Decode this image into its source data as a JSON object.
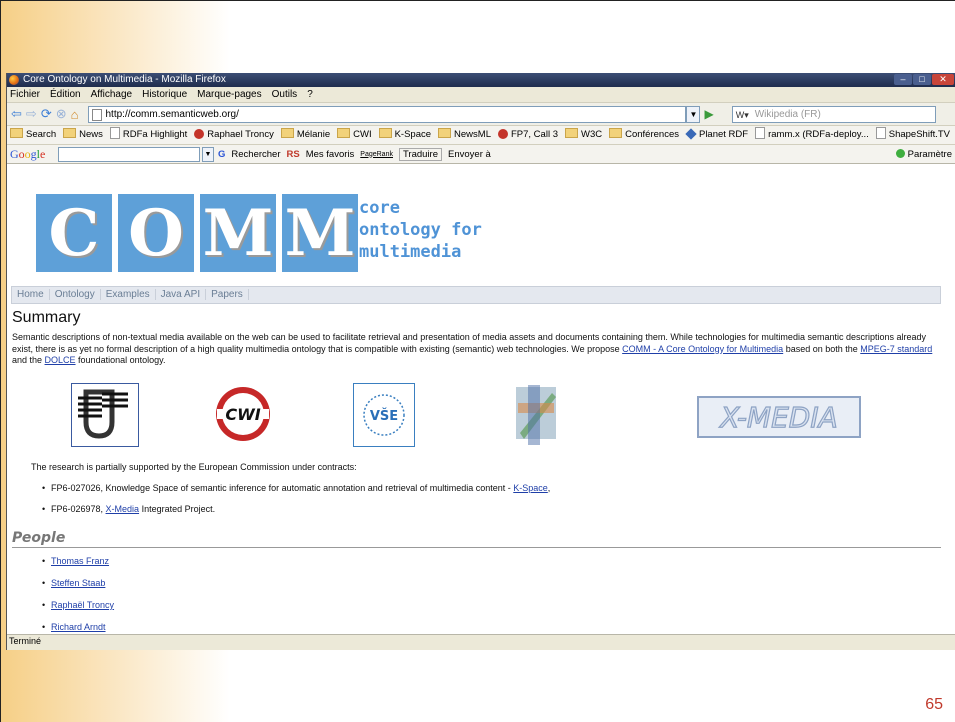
{
  "slide": {
    "page_number": "65"
  },
  "window": {
    "title": "Core Ontology on Multimedia - Mozilla Firefox"
  },
  "menubar": [
    "Fichier",
    "Édition",
    "Affichage",
    "Historique",
    "Marque-pages",
    "Outils",
    "?"
  ],
  "navbar": {
    "url": "http://comm.semanticweb.org/",
    "search_placeholder": "Wikipedia (FR)"
  },
  "bookmarks": [
    {
      "label": "Search",
      "icon": "folder"
    },
    {
      "label": "News",
      "icon": "folder"
    },
    {
      "label": "RDFa Highlight",
      "icon": "page"
    },
    {
      "label": "Raphael Troncy",
      "icon": "red"
    },
    {
      "label": "Mélanie",
      "icon": "folder"
    },
    {
      "label": "CWI",
      "icon": "folder"
    },
    {
      "label": "K-Space",
      "icon": "folder"
    },
    {
      "label": "NewsML",
      "icon": "folder"
    },
    {
      "label": "FP7, Call 3",
      "icon": "red"
    },
    {
      "label": "W3C",
      "icon": "folder"
    },
    {
      "label": "Conférences",
      "icon": "folder"
    },
    {
      "label": "Planet RDF",
      "icon": "blue"
    },
    {
      "label": "ramm.x (RDFa-deploy...",
      "icon": "page"
    },
    {
      "label": "ShapeShift.TV",
      "icon": "page"
    }
  ],
  "google_bar": {
    "rechercher": "Rechercher",
    "rs": "RS",
    "mes_favoris": "Mes favoris",
    "pagerank": "PageRank",
    "traduire": "Traduire",
    "envoyer": "Envoyer à",
    "parametres": "Paramètre"
  },
  "site": {
    "logo_letters": [
      "C",
      "O",
      "M",
      "M"
    ],
    "tagline": [
      "core",
      "ontology for",
      "multimedia"
    ],
    "nav": [
      "Home",
      "Ontology",
      "Examples",
      "Java API",
      "Papers"
    ],
    "summary_title": "Summary",
    "summary": {
      "t1": "Semantic descriptions of non-textual media available on the web can be used to facilitate retrieval and presentation of media assets and documents containing them. While technologies for multimedia semantic descriptions already exist, there is as yet no formal description of a high quality multimedia ontology that is compatible with existing (semantic) web technologies. We propose ",
      "l1": "COMM - A Core Ontology for Multimedia",
      "t2": " based on both the ",
      "l2": "MPEG-7 standard",
      "t3": " and the ",
      "l3": "DOLCE",
      "t4": " foundational ontology."
    },
    "logos": {
      "cwi": "CWI",
      "vse": "VŠE",
      "xmedia": "X-MEDIA"
    },
    "support_text": "The research is partially supported by the European Commission under contracts:",
    "contracts": {
      "c1_text": "FP6-027026, Knowledge Space of semantic inference for automatic annotation and retrieval of multimedia content - ",
      "c1_link": "K-Space",
      "c1_end": ",",
      "c2_text": "FP6-026978, ",
      "c2_link": "X-Media",
      "c2_end": " Integrated Project."
    },
    "people_title": "People",
    "people": [
      "Thomas Franz",
      "Steffen Staab",
      "Raphaël Troncy",
      "Richard Arndt"
    ]
  },
  "status": "Terminé"
}
